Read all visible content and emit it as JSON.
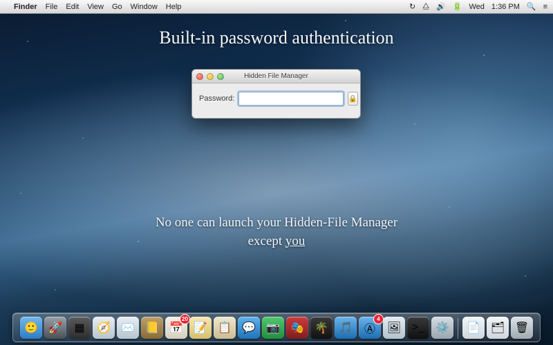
{
  "menubar": {
    "app_name": "Finder",
    "menus": [
      "File",
      "Edit",
      "View",
      "Go",
      "Window",
      "Help"
    ],
    "right": {
      "sync_icon": "↻",
      "wifi_icon": "⧋",
      "volume_icon": "🔊",
      "battery_icon": "🔋",
      "day": "Wed",
      "time": "1:36 PM",
      "spotlight_icon": "🔍",
      "notif_icon": "≡"
    }
  },
  "overlay": {
    "headline": "Built-in password authentication",
    "sub1": "No one can launch your Hidden-File Manager",
    "sub2_prefix": "except ",
    "sub2_underlined": "you"
  },
  "auth_window": {
    "title": "Hidden File Manager",
    "password_label": "Password:",
    "password_value": "",
    "lock_glyph": "🔒"
  },
  "dock": {
    "items": [
      {
        "name": "finder",
        "glyph": "🙂",
        "bg": "linear-gradient(#6fb9f0,#2d7bc6)"
      },
      {
        "name": "launchpad",
        "glyph": "🚀",
        "bg": "linear-gradient(#9aa0a6,#4b5055)"
      },
      {
        "name": "mission",
        "glyph": "▦",
        "bg": "linear-gradient(#5b5b5b,#2d2d2d)"
      },
      {
        "name": "safari",
        "glyph": "🧭",
        "bg": "linear-gradient(#e8edf2,#b9c4cd)"
      },
      {
        "name": "mail",
        "glyph": "✉️",
        "bg": "linear-gradient(#e8edf2,#b9c4cd)"
      },
      {
        "name": "contacts",
        "glyph": "📒",
        "bg": "linear-gradient(#bfa06a,#8a6a37)"
      },
      {
        "name": "calendar",
        "glyph": "📅",
        "bg": "linear-gradient(#f5f0e6,#d6cfbe)",
        "badge": "20"
      },
      {
        "name": "notes",
        "glyph": "📝",
        "bg": "linear-gradient(#f7e8b0,#d8c06a)"
      },
      {
        "name": "reminders",
        "glyph": "📋",
        "bg": "linear-gradient(#efe7cf,#c9bd96)"
      },
      {
        "name": "messages",
        "glyph": "💬",
        "bg": "linear-gradient(#5cb3f0,#1f73b8)"
      },
      {
        "name": "facetime",
        "glyph": "📷",
        "bg": "linear-gradient(#51c96e,#1f8f3c)"
      },
      {
        "name": "photobooth",
        "glyph": "🎭",
        "bg": "linear-gradient(#d03a3a,#7d1e1e)"
      },
      {
        "name": "iphoto",
        "glyph": "🌴",
        "bg": "linear-gradient(#3a3a3a,#111)"
      },
      {
        "name": "itunes",
        "glyph": "🎵",
        "bg": "linear-gradient(#6ab4ea,#1c6db1)"
      },
      {
        "name": "appstore",
        "glyph": "Ⓐ",
        "bg": "linear-gradient(#6ab4ea,#1c6db1)",
        "badge": "4"
      },
      {
        "name": "preview",
        "glyph": "🖼",
        "bg": "linear-gradient(#e4ecf2,#b4c2cc)"
      },
      {
        "name": "terminal",
        "glyph": ">_",
        "bg": "linear-gradient(#3a3a3a,#0f0f0f)"
      },
      {
        "name": "sysprefs",
        "glyph": "⚙️",
        "bg": "linear-gradient(#d6dde3,#9aa5ad)"
      }
    ],
    "right_items": [
      {
        "name": "downloads",
        "glyph": "📄",
        "bg": "linear-gradient(#f4f6f8,#cfd6db)"
      },
      {
        "name": "documents",
        "glyph": "🗂",
        "bg": "linear-gradient(#f4f6f8,#cfd6db)"
      }
    ],
    "trash_glyph": "🗑"
  }
}
